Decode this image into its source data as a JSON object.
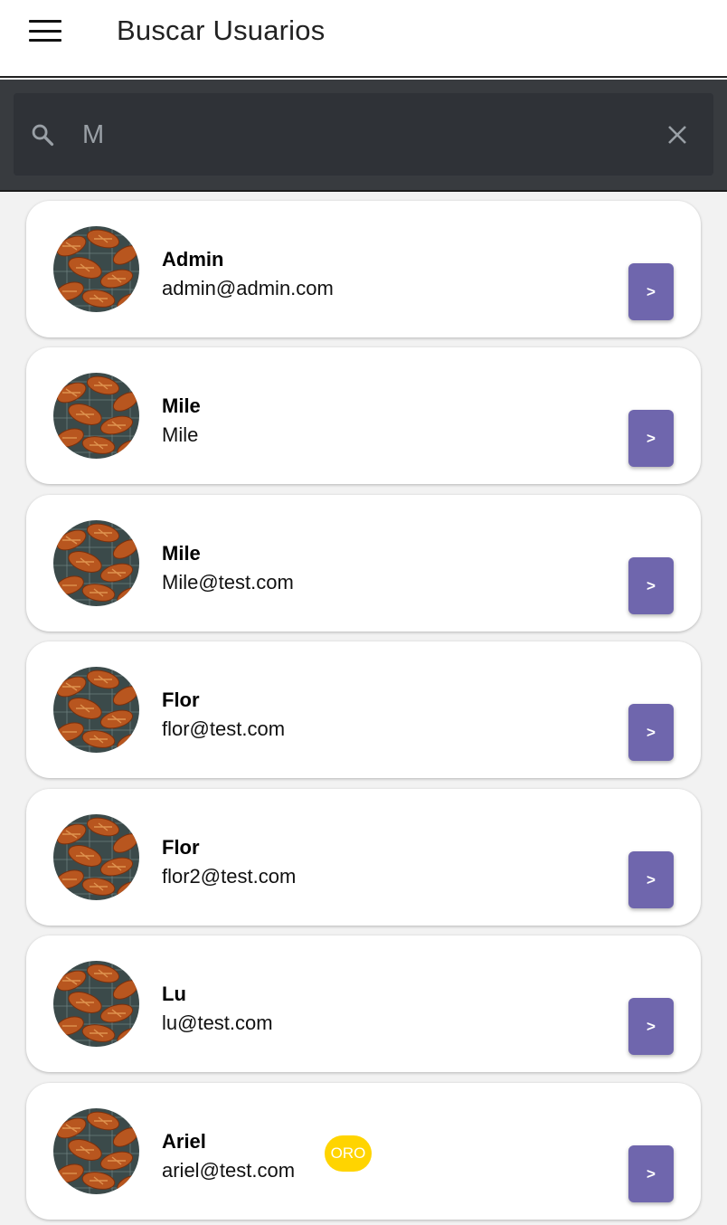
{
  "header": {
    "title": "Buscar Usuarios",
    "menu_icon": "hamburger-menu-icon"
  },
  "search": {
    "value": "M",
    "icons": {
      "search": "search-icon",
      "clear": "close-icon"
    }
  },
  "colors": {
    "button": "#6f66ad",
    "badge": "#ffd400",
    "search_bg": "#383b3f"
  },
  "users": [
    {
      "name": "Admin",
      "email": "admin@admin.com",
      "button_label": ">"
    },
    {
      "name": "Mile",
      "email": "Mile",
      "button_label": ">"
    },
    {
      "name": "Mile",
      "email": "Mile@test.com",
      "button_label": ">"
    },
    {
      "name": "Flor",
      "email": "flor@test.com",
      "button_label": ">"
    },
    {
      "name": "Flor",
      "email": "flor2@test.com",
      "button_label": ">"
    },
    {
      "name": "Lu",
      "email": "lu@test.com",
      "button_label": ">"
    },
    {
      "name": "Ariel",
      "email": "ariel@test.com",
      "badge": "ORO",
      "button_label": ">"
    }
  ]
}
